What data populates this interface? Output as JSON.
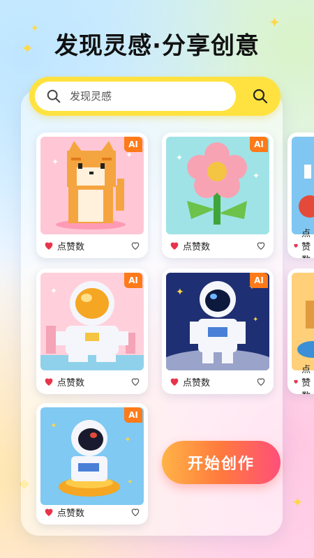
{
  "header": {
    "title": "发现灵感·分享创意"
  },
  "search": {
    "placeholder": "发现灵感"
  },
  "cards": [
    {
      "badge": "AI",
      "like_label": "点赞数",
      "subject": "pixel-cat"
    },
    {
      "badge": "AI",
      "like_label": "点赞数",
      "subject": "pixel-flower"
    },
    {
      "badge": "AI",
      "like_label": "点赞数",
      "subject": "pixel-astronaut-sitting"
    },
    {
      "badge": "AI",
      "like_label": "点赞数",
      "subject": "pixel-astronaut-moon"
    },
    {
      "badge": "AI",
      "like_label": "点赞数",
      "subject": "pixel-astronaut-ufo"
    },
    {
      "like_label": "点赞数"
    },
    {
      "like_label": "点赞数"
    }
  ],
  "actions": {
    "create_label": "开始创作"
  },
  "colors": {
    "accent_yellow": "#ffe23f",
    "badge_orange": "#ff7a18",
    "heart_red": "#e8344b",
    "button_gradient_start": "#ffb347",
    "button_gradient_end": "#ff4f7a"
  }
}
